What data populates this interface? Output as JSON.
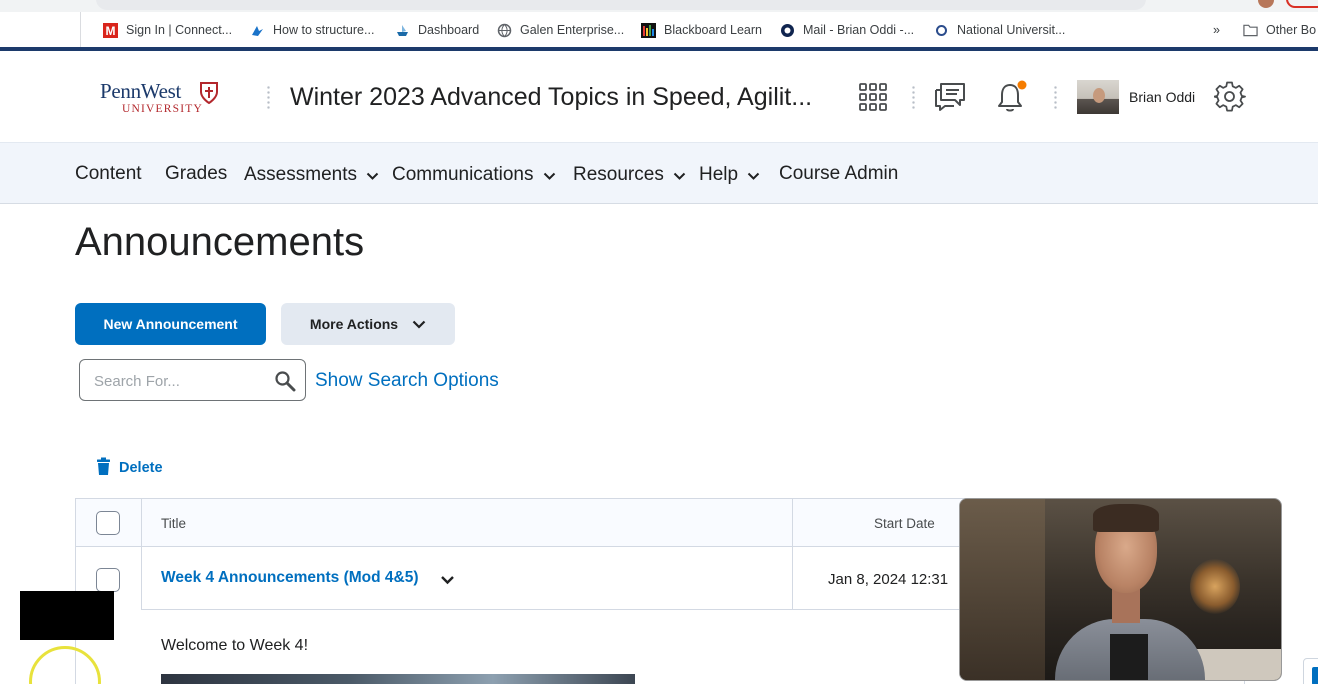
{
  "browser": {
    "bookmarks": [
      {
        "label": "Sign In | Connect...",
        "icon": "mcgraw-hill-icon"
      },
      {
        "label": "How to structure...",
        "icon": "bird-icon"
      },
      {
        "label": "Dashboard",
        "icon": "ship-icon"
      },
      {
        "label": "Galen Enterprise...",
        "icon": "globe-icon"
      },
      {
        "label": "Blackboard Learn",
        "icon": "blackboard-icon"
      },
      {
        "label": "Mail - Brian Oddi -...",
        "icon": "outlook-icon"
      },
      {
        "label": "National Universit...",
        "icon": "circle-icon"
      }
    ],
    "overflow_label": "»",
    "other_bookmarks_label": "Other Bo"
  },
  "navbar": {
    "logo_text": "PennWest",
    "logo_sub": "UNIVERSITY",
    "course_title": "Winter 2023 Advanced Topics in Speed, Agilit...",
    "user_name": "Brian Oddi",
    "notification_color": "#f57c00"
  },
  "menu": {
    "items": [
      {
        "label": "Content",
        "has_dropdown": false
      },
      {
        "label": "Grades",
        "has_dropdown": false
      },
      {
        "label": "Assessments",
        "has_dropdown": true
      },
      {
        "label": "Communications",
        "has_dropdown": true
      },
      {
        "label": "Resources",
        "has_dropdown": true
      },
      {
        "label": "Help",
        "has_dropdown": true
      },
      {
        "label": "Course Admin",
        "has_dropdown": false
      }
    ]
  },
  "main": {
    "page_title": "Announcements",
    "new_button": "New Announcement",
    "more_actions": "More Actions",
    "search_placeholder": "Search For...",
    "search_options": "Show Search Options",
    "delete_label": "Delete",
    "table": {
      "headers": {
        "title": "Title",
        "start_date": "Start Date"
      },
      "rows": [
        {
          "title": "Week 4 Announcements (Mod 4&5)",
          "start_date": "Jan 8, 2024 12:31"
        }
      ]
    },
    "welcome_text": "Welcome to Week 4!"
  },
  "colors": {
    "accent": "#006fbf",
    "brand_navy": "#1c3a6b",
    "brand_red": "#b3282d",
    "menu_bg": "#f1f5fb"
  }
}
